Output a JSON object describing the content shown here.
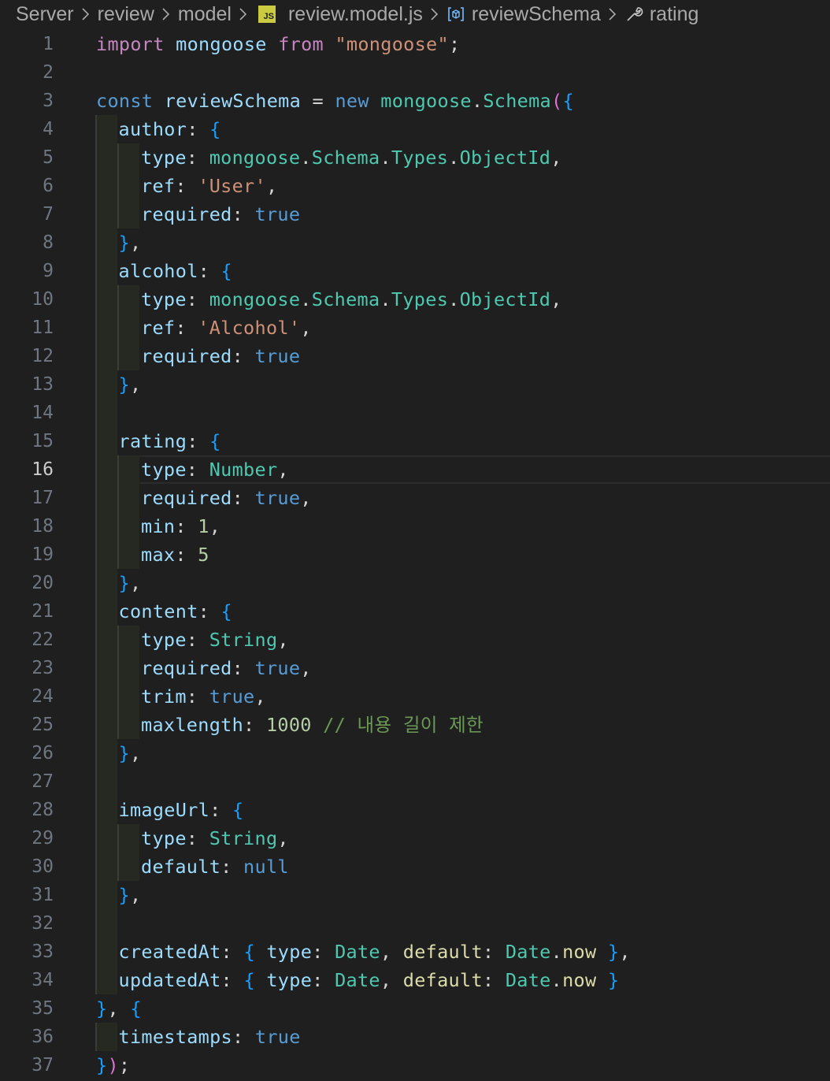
{
  "breadcrumb": {
    "items": [
      "Server",
      "review",
      "model",
      "review.model.js",
      "reviewSchema",
      "rating"
    ],
    "file_badge": "JS"
  },
  "editor": {
    "current_line": 16,
    "line_numbers": [
      "1",
      "2",
      "3",
      "4",
      "5",
      "6",
      "7",
      "8",
      "9",
      "10",
      "11",
      "12",
      "13",
      "14",
      "15",
      "16",
      "17",
      "18",
      "19",
      "20",
      "21",
      "22",
      "23",
      "24",
      "25",
      "26",
      "27",
      "28",
      "29",
      "30",
      "31",
      "32",
      "33",
      "34",
      "35",
      "36",
      "37"
    ],
    "lines": [
      [
        [
          "k",
          "import"
        ],
        [
          "p",
          " "
        ],
        [
          "v",
          "mongoose"
        ],
        [
          "p",
          " "
        ],
        [
          "k",
          "from"
        ],
        [
          "p",
          " "
        ],
        [
          "s",
          "\"mongoose\""
        ],
        [
          "p",
          ";"
        ]
      ],
      [],
      [
        [
          "t",
          "const"
        ],
        [
          "p",
          " "
        ],
        [
          "v",
          "reviewSchema"
        ],
        [
          "p",
          " = "
        ],
        [
          "t",
          "new"
        ],
        [
          "p",
          " "
        ],
        [
          "c",
          "mongoose"
        ],
        [
          "p",
          "."
        ],
        [
          "c",
          "Schema"
        ],
        [
          "b1",
          "("
        ],
        [
          "b2",
          "{"
        ]
      ],
      [
        [
          "v",
          "author"
        ],
        [
          "p",
          ": "
        ],
        [
          "b2",
          "{"
        ]
      ],
      [
        [
          "v",
          "type"
        ],
        [
          "p",
          ": "
        ],
        [
          "c",
          "mongoose"
        ],
        [
          "p",
          "."
        ],
        [
          "c",
          "Schema"
        ],
        [
          "p",
          "."
        ],
        [
          "c",
          "Types"
        ],
        [
          "p",
          "."
        ],
        [
          "c",
          "ObjectId"
        ],
        [
          "p",
          ","
        ]
      ],
      [
        [
          "v",
          "ref"
        ],
        [
          "p",
          ": "
        ],
        [
          "s",
          "'User'"
        ],
        [
          "p",
          ","
        ]
      ],
      [
        [
          "v",
          "required"
        ],
        [
          "p",
          ": "
        ],
        [
          "t",
          "true"
        ]
      ],
      [
        [
          "b2",
          "}"
        ],
        [
          "p",
          ","
        ]
      ],
      [
        [
          "v",
          "alcohol"
        ],
        [
          "p",
          ": "
        ],
        [
          "b2",
          "{"
        ]
      ],
      [
        [
          "v",
          "type"
        ],
        [
          "p",
          ": "
        ],
        [
          "c",
          "mongoose"
        ],
        [
          "p",
          "."
        ],
        [
          "c",
          "Schema"
        ],
        [
          "p",
          "."
        ],
        [
          "c",
          "Types"
        ],
        [
          "p",
          "."
        ],
        [
          "c",
          "ObjectId"
        ],
        [
          "p",
          ","
        ]
      ],
      [
        [
          "v",
          "ref"
        ],
        [
          "p",
          ": "
        ],
        [
          "s",
          "'Alcohol'"
        ],
        [
          "p",
          ","
        ]
      ],
      [
        [
          "v",
          "required"
        ],
        [
          "p",
          ": "
        ],
        [
          "t",
          "true"
        ]
      ],
      [
        [
          "b2",
          "}"
        ],
        [
          "p",
          ","
        ]
      ],
      [],
      [
        [
          "v",
          "rating"
        ],
        [
          "p",
          ": "
        ],
        [
          "b2",
          "{"
        ]
      ],
      [
        [
          "v",
          "type"
        ],
        [
          "p",
          ": "
        ],
        [
          "c",
          "Number"
        ],
        [
          "p",
          ","
        ]
      ],
      [
        [
          "v",
          "required"
        ],
        [
          "p",
          ": "
        ],
        [
          "t",
          "true"
        ],
        [
          "p",
          ","
        ]
      ],
      [
        [
          "v",
          "min"
        ],
        [
          "p",
          ": "
        ],
        [
          "n",
          "1"
        ],
        [
          "p",
          ","
        ]
      ],
      [
        [
          "v",
          "max"
        ],
        [
          "p",
          ": "
        ],
        [
          "n",
          "5"
        ]
      ],
      [
        [
          "b2",
          "}"
        ],
        [
          "p",
          ","
        ]
      ],
      [
        [
          "v",
          "content"
        ],
        [
          "p",
          ": "
        ],
        [
          "b2",
          "{"
        ]
      ],
      [
        [
          "v",
          "type"
        ],
        [
          "p",
          ": "
        ],
        [
          "c",
          "String"
        ],
        [
          "p",
          ","
        ]
      ],
      [
        [
          "v",
          "required"
        ],
        [
          "p",
          ": "
        ],
        [
          "t",
          "true"
        ],
        [
          "p",
          ","
        ]
      ],
      [
        [
          "v",
          "trim"
        ],
        [
          "p",
          ": "
        ],
        [
          "t",
          "true"
        ],
        [
          "p",
          ","
        ]
      ],
      [
        [
          "v",
          "maxlength"
        ],
        [
          "p",
          ": "
        ],
        [
          "n",
          "1000"
        ],
        [
          "p",
          " "
        ],
        [
          "m",
          "// 내용 길이 제한"
        ]
      ],
      [
        [
          "b2",
          "}"
        ],
        [
          "p",
          ","
        ]
      ],
      [],
      [
        [
          "v",
          "imageUrl"
        ],
        [
          "p",
          ": "
        ],
        [
          "b2",
          "{"
        ]
      ],
      [
        [
          "v",
          "type"
        ],
        [
          "p",
          ": "
        ],
        [
          "c",
          "String"
        ],
        [
          "p",
          ","
        ]
      ],
      [
        [
          "v",
          "default"
        ],
        [
          "p",
          ": "
        ],
        [
          "t",
          "null"
        ]
      ],
      [
        [
          "b2",
          "}"
        ],
        [
          "p",
          ","
        ]
      ],
      [],
      [
        [
          "v",
          "createdAt"
        ],
        [
          "p",
          ": "
        ],
        [
          "b2",
          "{"
        ],
        [
          "p",
          " "
        ],
        [
          "v",
          "type"
        ],
        [
          "p",
          ": "
        ],
        [
          "c",
          "Date"
        ],
        [
          "p",
          ", "
        ],
        [
          "f",
          "default"
        ],
        [
          "p",
          ": "
        ],
        [
          "c",
          "Date"
        ],
        [
          "p",
          "."
        ],
        [
          "f",
          "now"
        ],
        [
          "p",
          " "
        ],
        [
          "b2",
          "}"
        ],
        [
          "p",
          ","
        ]
      ],
      [
        [
          "v",
          "updatedAt"
        ],
        [
          "p",
          ": "
        ],
        [
          "b2",
          "{"
        ],
        [
          "p",
          " "
        ],
        [
          "v",
          "type"
        ],
        [
          "p",
          ": "
        ],
        [
          "c",
          "Date"
        ],
        [
          "p",
          ", "
        ],
        [
          "f",
          "default"
        ],
        [
          "p",
          ": "
        ],
        [
          "c",
          "Date"
        ],
        [
          "p",
          "."
        ],
        [
          "f",
          "now"
        ],
        [
          "p",
          " "
        ],
        [
          "b2",
          "}"
        ]
      ],
      [
        [
          "b2",
          "}"
        ],
        [
          "p",
          ", "
        ],
        [
          "b2",
          "{"
        ]
      ],
      [
        [
          "v",
          "timestamps"
        ],
        [
          "p",
          ": "
        ],
        [
          "t",
          "true"
        ]
      ],
      [
        [
          "b2",
          "}"
        ],
        [
          "b1",
          ")"
        ],
        [
          "p",
          ";"
        ]
      ]
    ]
  }
}
